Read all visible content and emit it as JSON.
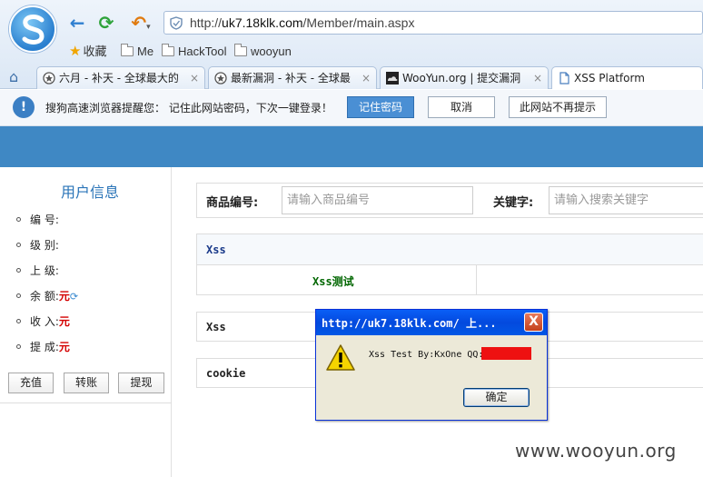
{
  "browser": {
    "url_prefix": "http://",
    "url_domain": "uk7.18klk.com",
    "url_path": "/Member/main.aspx",
    "bookmarks": [
      "收藏",
      "Me",
      "HackTool",
      "wooyun"
    ],
    "tabs": [
      {
        "label": "六月 - 补天 - 全球最大的",
        "close": "×"
      },
      {
        "label": "最新漏洞 - 补天 - 全球最",
        "close": "×"
      },
      {
        "label": "WooYun.org | 提交漏洞",
        "close": "×"
      },
      {
        "label": "XSS Platform",
        "close": ""
      }
    ]
  },
  "password_bar": {
    "message": "搜狗高速浏览器提醒您： 记住此网站密码，下次一键登录！",
    "remember": "记住密码",
    "cancel": "取消",
    "never": "此网站不再提示"
  },
  "sidebar": {
    "title": "用户信息",
    "items": [
      {
        "label": "编  号:",
        "value": ""
      },
      {
        "label": "级  别:",
        "value": ""
      },
      {
        "label": "上  级:",
        "value": ""
      },
      {
        "label": "余  额:",
        "value": "元"
      },
      {
        "label": "收  入:",
        "value": "元"
      },
      {
        "label": "提  成:",
        "value": "元"
      }
    ],
    "buttons": [
      "充值",
      "转账",
      "提现"
    ]
  },
  "search": {
    "product_label": "商品编号:",
    "product_placeholder": "请输入商品编号",
    "keyword_label": "关键字:",
    "keyword_placeholder": "请输入搜索关键字"
  },
  "table": {
    "row1": "Xss",
    "row2": "Xss测试",
    "row3": "Xss",
    "row4": "cookie"
  },
  "alert": {
    "title": "http://uk7.18klk.com/ 上...",
    "message": "Xss Test By:KxOne QQ:",
    "ok": "确定",
    "close": "X"
  },
  "watermark": "www.wooyun.org",
  "colors": {
    "banner": "#3f88c4",
    "accent": "#2a74b8",
    "money": "#d40000",
    "link_green": "#006600"
  }
}
